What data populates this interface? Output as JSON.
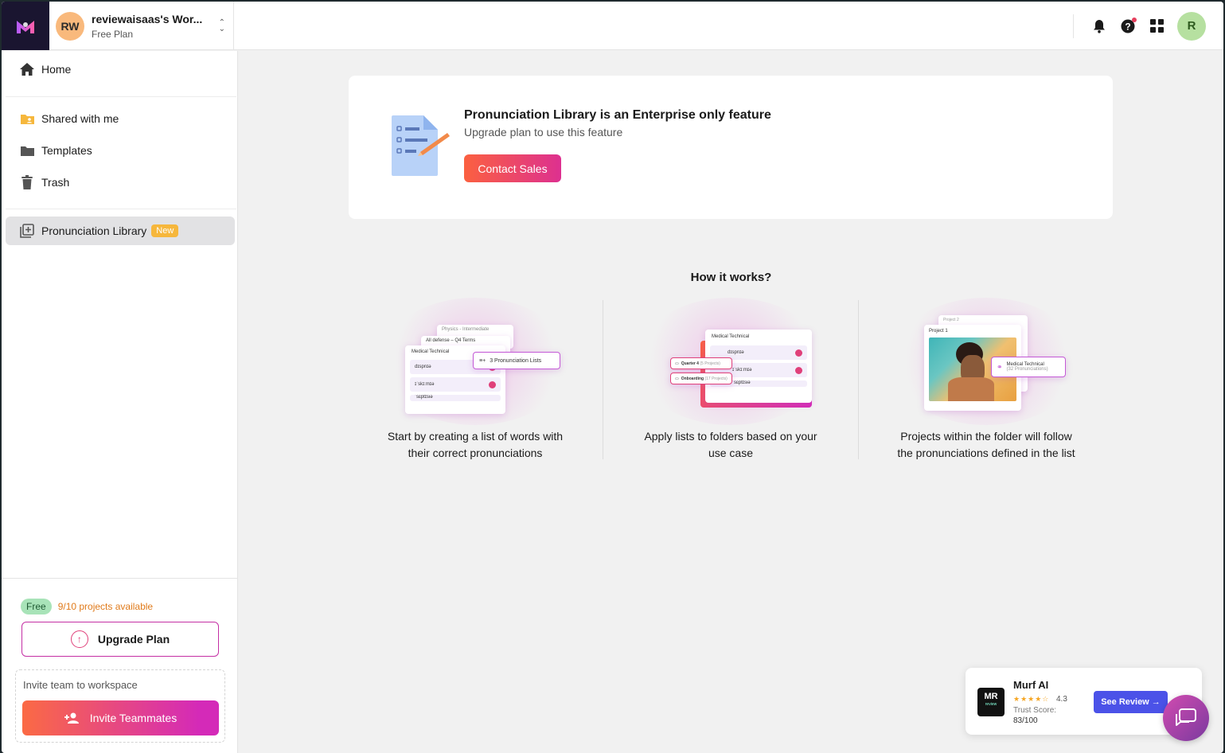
{
  "brand": {
    "logo_icon": "murf-logo-icon",
    "accent": "#e0407a"
  },
  "workspace": {
    "initials": "RW",
    "name": "reviewaisaas's Wor...",
    "plan": "Free Plan"
  },
  "topbar": {
    "icons": [
      "bell-icon",
      "help-icon",
      "apps-grid-icon"
    ],
    "user_initial": "R"
  },
  "sidebar": {
    "items": [
      {
        "label": "Home",
        "icon": "home-icon"
      },
      {
        "label": "Shared with me",
        "icon": "shared-folder-icon"
      },
      {
        "label": "Templates",
        "icon": "folder-icon"
      },
      {
        "label": "Trash",
        "icon": "trash-icon"
      },
      {
        "label": "Pronunciation Library",
        "icon": "library-add-icon",
        "badge": "New",
        "active": true
      }
    ],
    "plan_badge": "Free",
    "projects_available": "9/10 projects available",
    "upgrade_label": "Upgrade Plan",
    "invite_label": "Invite team to workspace",
    "invite_button": "Invite Teammates"
  },
  "feature_card": {
    "title": "Pronunciation Library is an Enterprise only feature",
    "subtitle": "Upgrade plan to use this feature",
    "cta": "Contact Sales"
  },
  "how_it_works": {
    "title": "How it works?",
    "steps": [
      {
        "line1": "Start by creating a list of words with",
        "line2": "their correct pronunciations",
        "mock": {
          "back1": "Physics - Intermediate",
          "back2": "All defense – Q4 Terms",
          "front": "Medical Technical",
          "chip": "3 Pronunciation Lists",
          "words": [
            "dɪspnɪə",
            "ɪˈskɪːmɪə",
            "ˈsɛptɪsiə"
          ]
        }
      },
      {
        "line1": "Apply lists to folders based on your",
        "line2": "use case",
        "mock": {
          "front": "Medical Technical",
          "chip1": "Quarter 4",
          "chip1_sub": "(5 Projects)",
          "chip2": "Onboarding",
          "chip2_sub": "(17 Projects)",
          "words": [
            "dɪspnɪə",
            "ɪˈskɪːmɪə",
            "ˈsɛptɪsiə"
          ]
        }
      },
      {
        "line1": "Projects within the folder will follow",
        "line2": "the pronunciations defined in the list",
        "mock": {
          "back": "Project 2",
          "front": "Project 1",
          "chip": "Medical Technical",
          "chip_sub": "(32 Pronunciations)"
        }
      }
    ]
  },
  "review_widget": {
    "logo_text": "MR",
    "logo_sub": "review",
    "name": "Murf AI",
    "stars": "★★★★☆",
    "rating": "4.3",
    "trust_label": "Trust Score:",
    "trust_score": "83/100",
    "button": "See Review →"
  }
}
